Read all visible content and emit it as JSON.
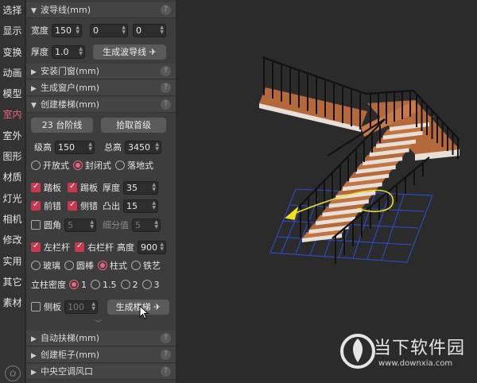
{
  "nav": [
    "选择",
    "显示",
    "变换",
    "动画",
    "模型",
    "室内",
    "室外",
    "图形",
    "材质",
    "灯光",
    "相机",
    "修改",
    "实用",
    "其它",
    "素材"
  ],
  "nav_active": "室内",
  "sections": {
    "waveline": "波导线(mm)",
    "doors": "安装门窗(mm)",
    "windows": "生成窗户(mm)",
    "stairs": "创建楼梯(mm)",
    "handrail": "自动扶梯(mm)",
    "cabinet": "创建柜子(mm)",
    "ac": "中央空调风口"
  },
  "waveline": {
    "width_label": "宽度",
    "width": "150",
    "v2": "0",
    "v3": "0",
    "thick_label": "厚度",
    "thick": "1.0",
    "gen_btn": "生成波导线"
  },
  "stairs": {
    "steps_btn": "23 台阶线",
    "pick_btn": "拾取首级",
    "step_h_label": "级高",
    "step_h": "150",
    "total_h_label": "总高",
    "total_h": "3450",
    "types": [
      "开放式",
      "封闭式",
      "落地式"
    ],
    "tread": "踏板",
    "riser": "踢板",
    "thick_label": "厚度",
    "thick": "35",
    "front_edge": "前错",
    "side_edge": "侧错",
    "protrude_label": "凸出",
    "protrude": "15",
    "round": "圆角",
    "round_val": "5",
    "subdiv_label": "细分值",
    "subdiv_val": "5",
    "left_rail": "左栏杆",
    "right_rail": "右栏杆",
    "height_label": "高度",
    "height": "900",
    "rail_types": [
      "玻璃",
      "圆棒",
      "柱式",
      "铁艺"
    ],
    "density_label": "立柱密度",
    "densities": [
      "1",
      "1.5",
      "2",
      "3"
    ],
    "side_board": "侧板",
    "side_board_val": "100",
    "gen_btn": "生成楼梯"
  },
  "watermark": {
    "text": "当下软件园",
    "url": "www.downxia.com"
  },
  "colors": {
    "accent": "#e9677a",
    "check": "#c8384f",
    "panel": "#3d3d3d",
    "header": "#444444",
    "viewport": "#2b2b2b",
    "tread": "#b5683a"
  }
}
